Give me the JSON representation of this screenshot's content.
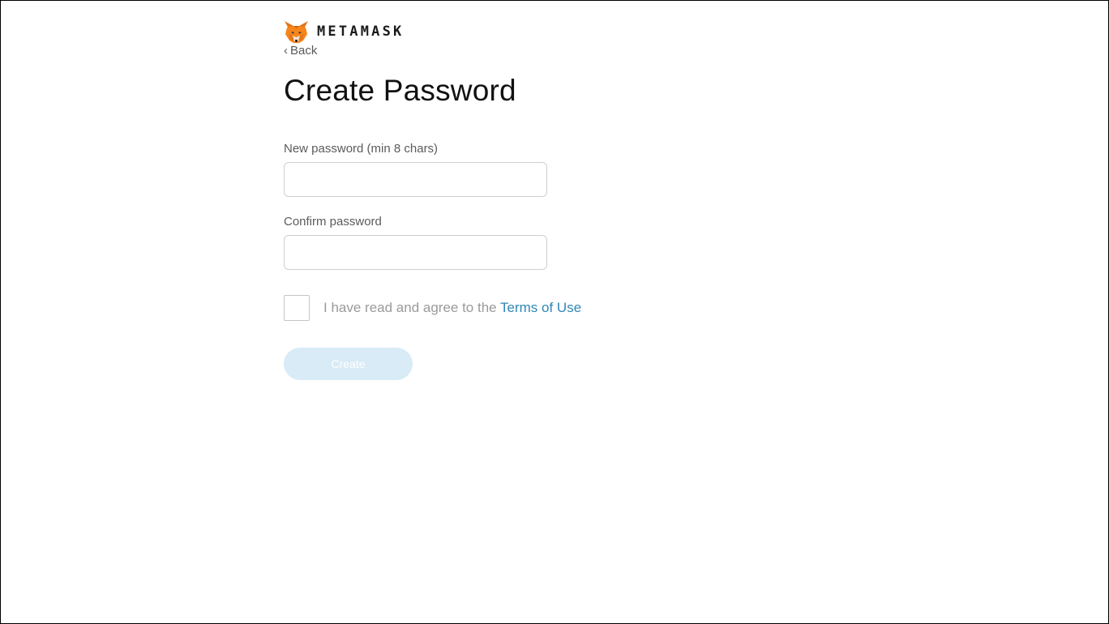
{
  "brand": {
    "logo_icon": "metamask-fox-icon",
    "name": "METAMASK"
  },
  "nav": {
    "back_chevron": "‹",
    "back_label": "Back"
  },
  "page": {
    "title": "Create Password"
  },
  "form": {
    "new_password": {
      "label": "New password (min 8 chars)",
      "value": "",
      "placeholder": ""
    },
    "confirm_password": {
      "label": "Confirm password",
      "value": "",
      "placeholder": ""
    },
    "terms": {
      "checked": false,
      "text": "I have read and agree to the ",
      "link_text": "Terms of Use"
    },
    "create_button": {
      "label": "Create",
      "enabled": false
    }
  },
  "colors": {
    "link": "#2f87b5",
    "button_disabled_bg": "#d8ebf7",
    "fox_orange": "#e2761b"
  }
}
